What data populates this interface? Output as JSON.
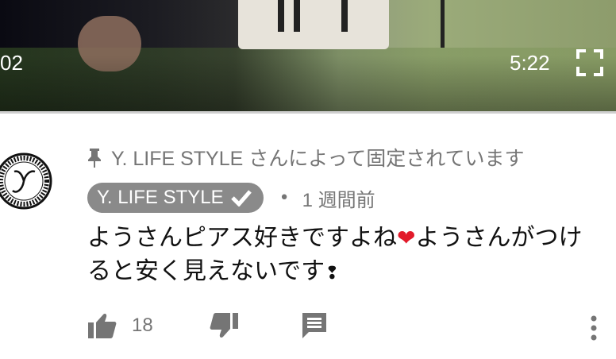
{
  "player": {
    "elapsed_partial": "02",
    "duration": "5:22",
    "fullscreen_icon": "fullscreen-icon"
  },
  "comment": {
    "pinned_text": "Y. LIFE STYLE さんによって固定されています",
    "author": "Y. LIFE STYLE",
    "separator": "•",
    "time_ago": "1 週間前",
    "body_part1": "ようさんピアス好きですよね",
    "body_part2": "ようさんがつけると安く見えないです",
    "heart": "❤",
    "exclamation": "❢",
    "like_count": "18"
  },
  "icons": {
    "pin": "pin-icon",
    "verified": "check-icon",
    "like": "thumbs-up-icon",
    "dislike": "thumbs-down-icon",
    "reply": "reply-icon",
    "more": "more-vert-icon"
  },
  "colors": {
    "secondary_text": "#757575",
    "chip_bg": "#8a8a8a",
    "heart": "#e21a2a"
  }
}
